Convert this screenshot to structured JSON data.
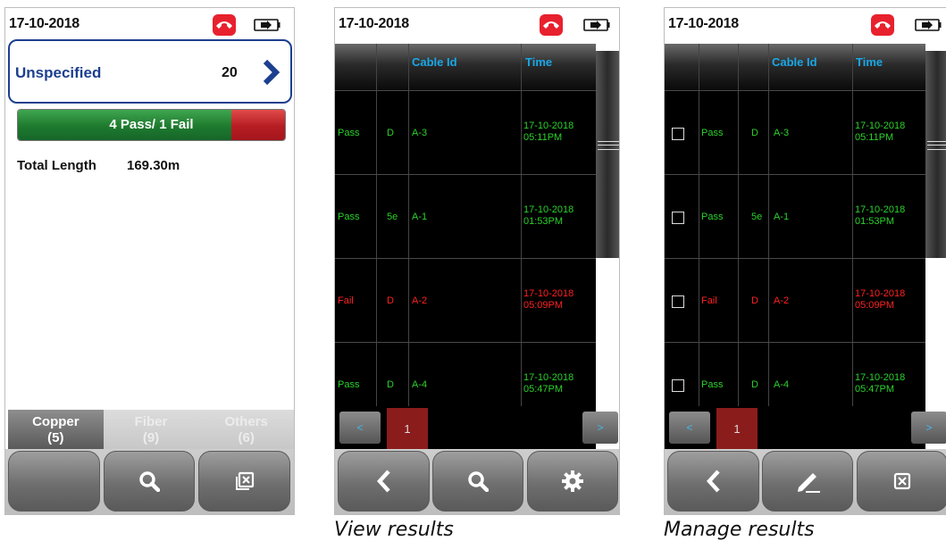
{
  "screen_view_summary": {
    "date": "17-10-2018",
    "project": {
      "name": "Unspecified",
      "count": "20"
    },
    "pass_fail": {
      "label": "4 Pass/ 1 Fail",
      "pass_fraction": 0.8
    },
    "total_length": {
      "label": "Total Length",
      "value": "169.30m"
    },
    "tabs": [
      {
        "name": "Copper",
        "count": "(5)",
        "active": true
      },
      {
        "name": "Fiber",
        "count": "(9)",
        "active": false
      },
      {
        "name": "Others",
        "count": "(6)",
        "active": false
      }
    ],
    "nav_icons": [
      "blank",
      "search-icon",
      "close-box-icon"
    ]
  },
  "screen_view_results": {
    "date": "17-10-2018",
    "columns": [
      "",
      "",
      "Cable Id",
      "Time"
    ],
    "rows": [
      {
        "status": "Pass",
        "cat": "D",
        "cable_id": "A-3",
        "date": "17-10-2018",
        "time": "05:11PM"
      },
      {
        "status": "Pass",
        "cat": "5e",
        "cable_id": "A-1",
        "date": "17-10-2018",
        "time": "01:53PM"
      },
      {
        "status": "Fail",
        "cat": "D",
        "cable_id": "A-2",
        "date": "17-10-2018",
        "time": "05:09PM"
      },
      {
        "status": "Pass",
        "cat": "D",
        "cable_id": "A-4",
        "date": "17-10-2018",
        "time": "05:47PM"
      }
    ],
    "pager": {
      "prev": "<",
      "page": "1",
      "next": ">"
    },
    "nav_icons": [
      "back-icon",
      "search-icon",
      "gear-icon"
    ]
  },
  "screen_manage_results": {
    "date": "17-10-2018",
    "columns": [
      "",
      "",
      "",
      "Cable Id",
      "Time"
    ],
    "rows": [
      {
        "status": "Pass",
        "cat": "D",
        "cable_id": "A-3",
        "date": "17-10-2018",
        "time": "05:11PM"
      },
      {
        "status": "Pass",
        "cat": "5e",
        "cable_id": "A-1",
        "date": "17-10-2018",
        "time": "01:53PM"
      },
      {
        "status": "Fail",
        "cat": "D",
        "cable_id": "A-2",
        "date": "17-10-2018",
        "time": "05:09PM"
      },
      {
        "status": "Pass",
        "cat": "D",
        "cable_id": "A-4",
        "date": "17-10-2018",
        "time": "05:47PM"
      }
    ],
    "pager": {
      "prev": "<",
      "page": "1",
      "next": ">"
    },
    "nav_icons": [
      "back-icon",
      "pencil-icon",
      "close-box-icon"
    ]
  },
  "captions": {
    "view": "View results",
    "manage": "Manage results"
  },
  "colors": {
    "pass": "#2bd12b",
    "fail": "#ff2020",
    "header_text": "#19a8e6",
    "project_accent": "#1c3f8f"
  }
}
